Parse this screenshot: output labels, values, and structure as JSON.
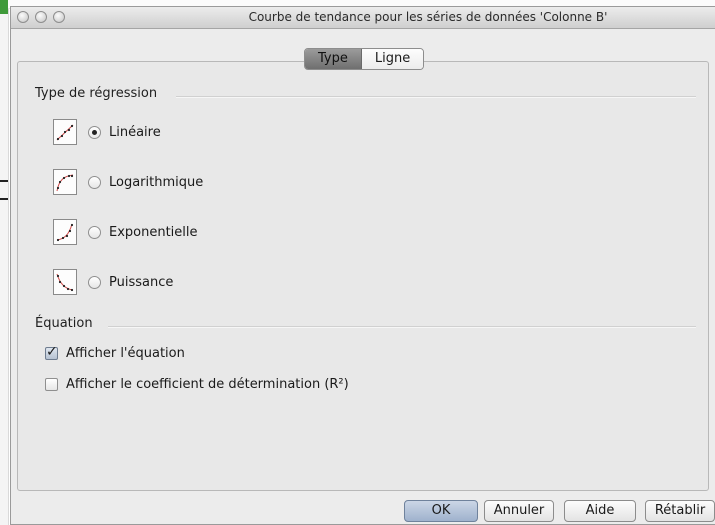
{
  "window": {
    "title": "Courbe de tendance pour les séries de données 'Colonne B'"
  },
  "tabs": [
    {
      "label": "Type",
      "active": true
    },
    {
      "label": "Ligne",
      "active": false
    }
  ],
  "regression": {
    "section_label": "Type de régression",
    "options": [
      {
        "label": "Linéaire",
        "selected": true,
        "icon": "linear-trend-icon"
      },
      {
        "label": "Logarithmique",
        "selected": false,
        "icon": "logarithmic-trend-icon"
      },
      {
        "label": "Exponentielle",
        "selected": false,
        "icon": "exponential-trend-icon"
      },
      {
        "label": "Puissance",
        "selected": false,
        "icon": "power-trend-icon"
      }
    ]
  },
  "equation": {
    "section_label": "Équation",
    "show_equation": {
      "label": "Afficher l'équation",
      "checked": true
    },
    "show_r2": {
      "label": "Afficher le coefficient de détermination (R²)",
      "checked": false
    }
  },
  "buttons": {
    "ok": "OK",
    "cancel": "Annuler",
    "help": "Aide",
    "reset": "Rétablir"
  },
  "colors": {
    "default_button": "#9fb2cd",
    "active_tab": "#7a7a7a",
    "trend_line": "#d04a4a",
    "chart_background_edge": "#3f9a3a"
  }
}
